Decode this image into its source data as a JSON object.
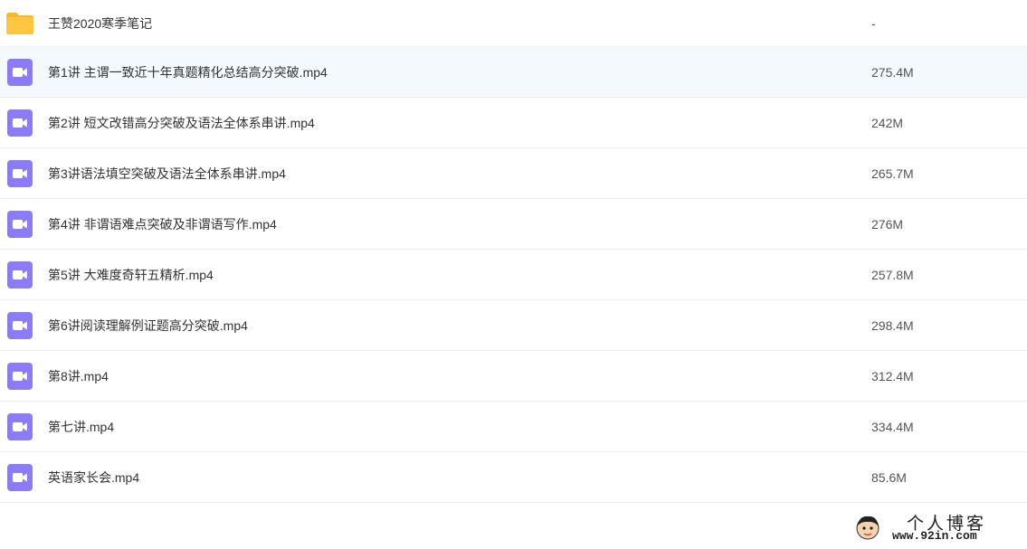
{
  "colors": {
    "folder": "#ffc741",
    "video_icon": "#8b7cf6",
    "selected_row": "#f4f9fe"
  },
  "files": [
    {
      "name": "王赞2020寒季笔记",
      "size": "-",
      "icon": "folder-icon"
    },
    {
      "name": "第1讲 主谓一致近十年真题精化总结高分突破.mp4",
      "size": "275.4M",
      "icon": "video-file-icon"
    },
    {
      "name": "第2讲 短文改错高分突破及语法全体系串讲.mp4",
      "size": "242M",
      "icon": "video-file-icon"
    },
    {
      "name": "第3讲语法填空突破及语法全体系串讲.mp4",
      "size": "265.7M",
      "icon": "video-file-icon"
    },
    {
      "name": "第4讲 非谓语难点突破及非谓语写作.mp4",
      "size": "276M",
      "icon": "video-file-icon"
    },
    {
      "name": "第5讲 大难度奇轩五精析.mp4",
      "size": "257.8M",
      "icon": "video-file-icon"
    },
    {
      "name": "第6讲阅读理解例证题高分突破.mp4",
      "size": "298.4M",
      "icon": "video-file-icon"
    },
    {
      "name": "第8讲.mp4",
      "size": "312.4M",
      "icon": "video-file-icon"
    },
    {
      "name": "第七讲.mp4",
      "size": "334.4M",
      "icon": "video-file-icon"
    },
    {
      "name": "英语家长会.mp4",
      "size": "85.6M",
      "icon": "video-file-icon"
    }
  ],
  "watermark": {
    "title": "个人博客",
    "url": "www.92in.com"
  }
}
